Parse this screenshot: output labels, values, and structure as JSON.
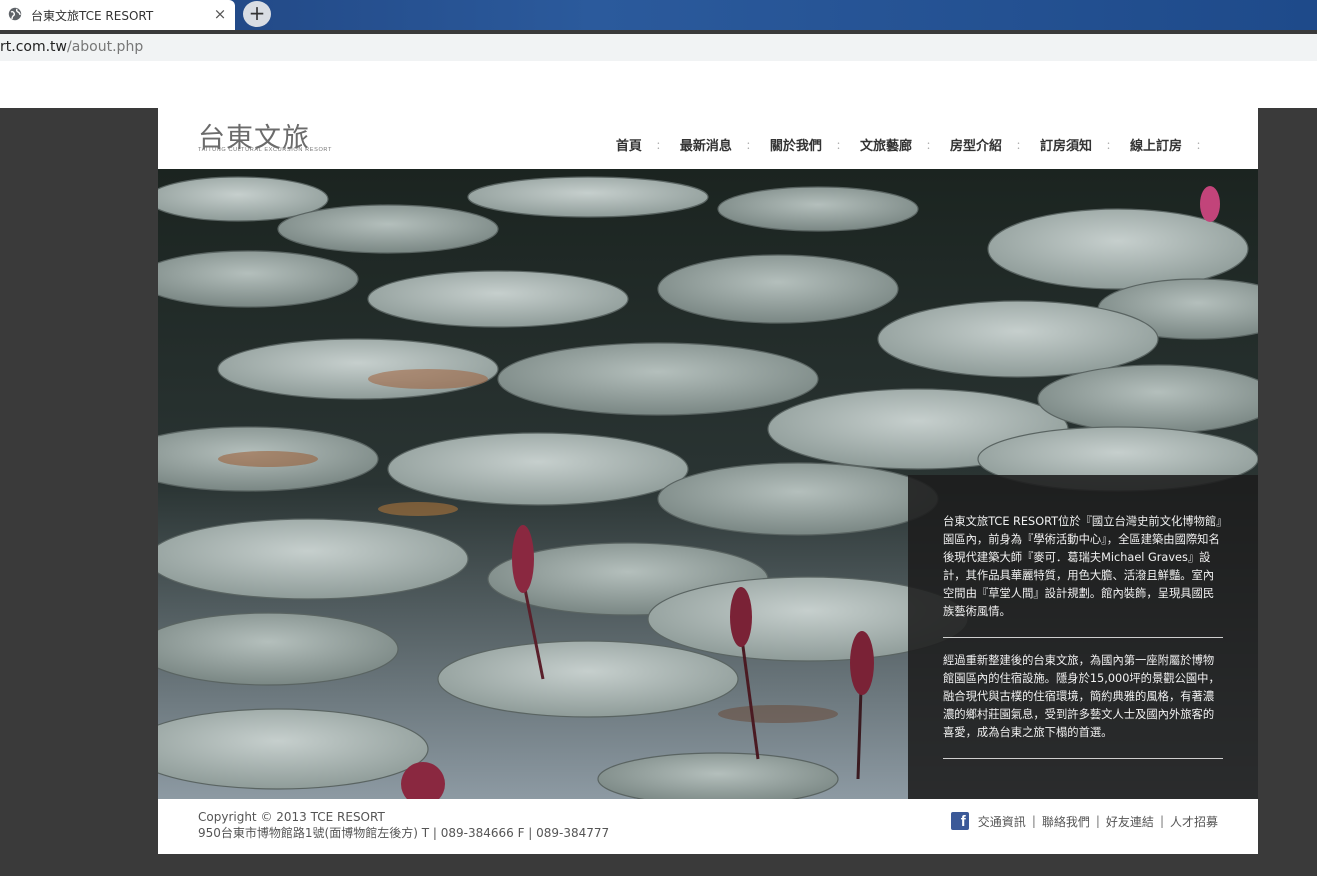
{
  "browser": {
    "tab_title": "台東文旅TCE RESORT",
    "close_glyph": "×",
    "newtab_glyph": "+",
    "url_host": "rt.com.tw",
    "url_path": "/about.php"
  },
  "site": {
    "logo_cn": "台東文旅",
    "logo_en": "TAITUNG CULTURAL EXCURSION RESORT",
    "nav": [
      {
        "label": "首頁"
      },
      {
        "label": "最新消息"
      },
      {
        "label": "關於我們"
      },
      {
        "label": "文旅藝廊"
      },
      {
        "label": "房型介紹"
      },
      {
        "label": "訂房須知"
      },
      {
        "label": "線上訂房"
      }
    ],
    "nav_separator": "：",
    "info": {
      "paragraph1": "台東文旅TCE RESORT位於『國立台灣史前文化博物館』園區內，前身為『學術活動中心』，全區建築由國際知名後現代建築大師『麥可．葛瑞夫Michael Graves』設計，其作品具華麗特質，用色大膽、活潑且鮮豔。室內空間由『草堂人間』設計規劃。館內裝飾，呈現具國民族藝術風情。",
      "paragraph2": "經過重新整建後的台東文旅，為國內第一座附屬於博物館園區內的住宿設施。隱身於15,000坪的景觀公園中，融合現代與古樸的住宿環境，簡約典雅的風格，有著濃濃的鄉村莊園氣息，受到許多藝文人士及國內外旅客的喜愛，成為台東之旅下榻的首選。"
    },
    "footer": {
      "copyright": "Copyright © 2013 TCE RESORT",
      "address": "950台東市博物館路1號(面博物館左後方) T | 089-384666 F | 089-384777",
      "fb_glyph": "f",
      "links": [
        "交通資訊",
        "聯絡我們",
        "好友連結",
        "人才招募"
      ],
      "link_sep": "|"
    },
    "colors": {
      "outer_bg": "#3a3a3a",
      "panel_bg": "rgba(28,28,28,0.88)",
      "facebook": "#3b5998"
    }
  }
}
